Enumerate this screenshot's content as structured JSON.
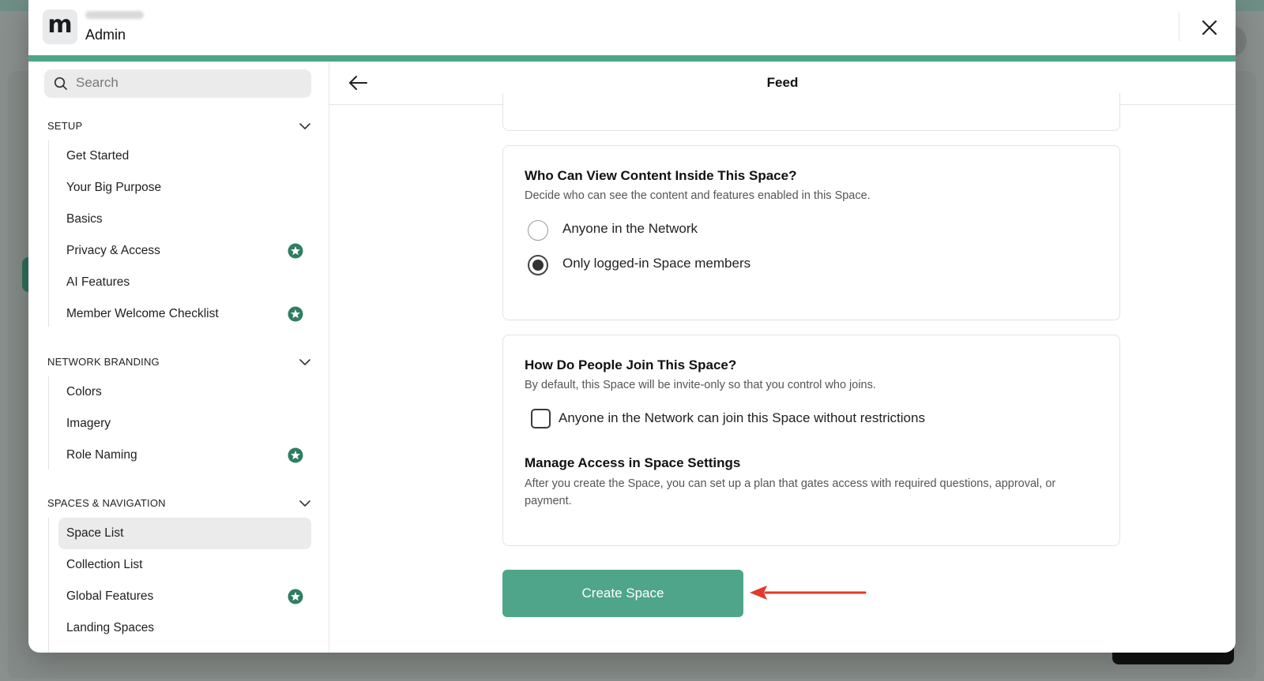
{
  "header": {
    "logo_letter": "m",
    "network_name": "",
    "title": "Admin"
  },
  "search": {
    "placeholder": "Search"
  },
  "sidebar": {
    "sections": [
      {
        "title": "SETUP",
        "items": [
          {
            "label": "Get Started",
            "starred": false
          },
          {
            "label": "Your Big Purpose",
            "starred": false
          },
          {
            "label": "Basics",
            "starred": false
          },
          {
            "label": "Privacy & Access",
            "starred": true
          },
          {
            "label": "AI Features",
            "starred": false
          },
          {
            "label": "Member Welcome Checklist",
            "starred": true
          }
        ]
      },
      {
        "title": "NETWORK BRANDING",
        "items": [
          {
            "label": "Colors",
            "starred": false
          },
          {
            "label": "Imagery",
            "starred": false
          },
          {
            "label": "Role Naming",
            "starred": true
          }
        ]
      },
      {
        "title": "SPACES & NAVIGATION",
        "items": [
          {
            "label": "Space List",
            "starred": false,
            "active": true
          },
          {
            "label": "Collection List",
            "starred": false
          },
          {
            "label": "Global Features",
            "starred": true
          },
          {
            "label": "Landing Spaces",
            "starred": false
          }
        ]
      }
    ]
  },
  "main": {
    "title": "Feed",
    "view_card": {
      "title": "Who Can View Content Inside This Space?",
      "description": "Decide who can see the content and features enabled in this Space.",
      "options": [
        {
          "label": "Anyone in the Network",
          "checked": false
        },
        {
          "label": "Only logged-in Space members",
          "checked": true
        }
      ]
    },
    "join_card": {
      "title": "How Do People Join This Space?",
      "description": "By default, this Space will be invite-only so that you control who joins.",
      "checkbox_label": "Anyone in the Network can join this Space without restrictions",
      "checkbox_checked": false,
      "manage_title": "Manage Access in Space Settings",
      "manage_description": "After you create the Space, you can set up a plan that gates access with required questions, approval, or payment."
    },
    "create_button": "Create Space"
  },
  "colors": {
    "accent": "#4fa58a",
    "annotation_arrow": "#e03a2a",
    "star_badge": "#2f7d63"
  }
}
